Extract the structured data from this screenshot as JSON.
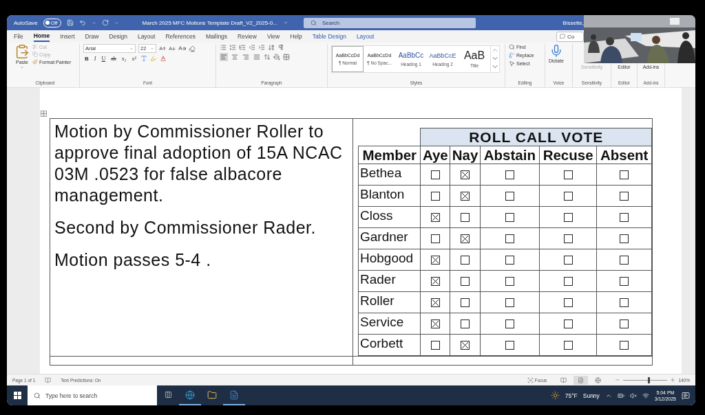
{
  "title_bar": {
    "autosave": {
      "label": "AutoSave",
      "state": "Off",
      "on": false
    },
    "document_title": "March 2025 MFC Motions Template Draft_V2_2025-0...",
    "search": {
      "placeholder": "Search"
    },
    "user": "Bissette,"
  },
  "ribbon_tabs": [
    {
      "label": "File",
      "selected": false,
      "contextual": false
    },
    {
      "label": "Home",
      "selected": true,
      "contextual": false
    },
    {
      "label": "Insert",
      "selected": false,
      "contextual": false
    },
    {
      "label": "Draw",
      "selected": false,
      "contextual": false
    },
    {
      "label": "Design",
      "selected": false,
      "contextual": false
    },
    {
      "label": "Layout",
      "selected": false,
      "contextual": false
    },
    {
      "label": "References",
      "selected": false,
      "contextual": false
    },
    {
      "label": "Mailings",
      "selected": false,
      "contextual": false
    },
    {
      "label": "Review",
      "selected": false,
      "contextual": false
    },
    {
      "label": "View",
      "selected": false,
      "contextual": false
    },
    {
      "label": "Help",
      "selected": false,
      "contextual": false
    },
    {
      "label": "Table Design",
      "selected": false,
      "contextual": true
    },
    {
      "label": "Layout",
      "selected": false,
      "contextual": true
    }
  ],
  "comments_button": "Co",
  "ribbon": {
    "clipboard": {
      "paste": "Paste",
      "cut": "Cut",
      "copy": "Copy",
      "format_painter": "Format Painter",
      "label": "Clipboard"
    },
    "font": {
      "name": "Arial",
      "size": "22",
      "label": "Font",
      "format_buttons": [
        {
          "label": "B",
          "kind": "bold"
        },
        {
          "label": "I",
          "kind": "italic"
        },
        {
          "label": "U",
          "kind": "underline"
        },
        {
          "label": "ab",
          "kind": "strike"
        },
        {
          "label": "x₂",
          "kind": "sub"
        },
        {
          "label": "x²",
          "kind": "sup"
        }
      ]
    },
    "paragraph": {
      "label": "Paragraph",
      "align_buttons": [
        {
          "kind": "left",
          "selected": true
        },
        {
          "kind": "center",
          "selected": false
        },
        {
          "kind": "right",
          "selected": false
        },
        {
          "kind": "justify",
          "selected": false
        }
      ]
    },
    "styles": {
      "label": "Styles",
      "items": [
        {
          "preview": "AaBbCcDd",
          "name": "¶ Normal",
          "kind": "normal",
          "selected": true
        },
        {
          "preview": "AaBbCcDd",
          "name": "¶ No Spac...",
          "kind": "nospacing",
          "selected": false
        },
        {
          "preview": "AaBbCc",
          "name": "Heading 1",
          "kind": "heading1",
          "selected": false
        },
        {
          "preview": "AaBbCcE",
          "name": "Heading 2",
          "kind": "heading2",
          "selected": false
        },
        {
          "preview": "AaB",
          "name": "Title",
          "kind": "title",
          "selected": false
        }
      ]
    },
    "editing": {
      "label": "Editing",
      "find": "Find",
      "replace": "Replace",
      "select": "Select"
    },
    "voice": {
      "label": "Voice",
      "dictate": "Dictate"
    },
    "sensitivity": {
      "label": "Sensitivity",
      "button": "Sensitivity",
      "disabled": true
    },
    "editor": {
      "label": "Editor",
      "button": "Editor"
    },
    "addins": {
      "label": "Add-ins",
      "button": "Add-ins"
    }
  },
  "document": {
    "motion_paragraphs": [
      "Motion by Commissioner Roller to approve final adoption of 15A NCAC 03M .0523 for false albacore management.",
      "Second by Commissioner Rader.",
      "Motion passes 5-4 ."
    ],
    "vote_table": {
      "title": "ROLL CALL VOTE",
      "member_header": "Member",
      "columns": [
        "Aye",
        "Nay",
        "Abstain",
        "Recuse",
        "Absent"
      ],
      "members": [
        {
          "name": "Bethea",
          "votes": [
            {
              "checked": false
            },
            {
              "checked": true
            },
            {
              "checked": false
            },
            {
              "checked": false
            },
            {
              "checked": false
            }
          ]
        },
        {
          "name": "Blanton",
          "votes": [
            {
              "checked": false
            },
            {
              "checked": true
            },
            {
              "checked": false
            },
            {
              "checked": false
            },
            {
              "checked": false
            }
          ]
        },
        {
          "name": "Closs",
          "votes": [
            {
              "checked": true
            },
            {
              "checked": false
            },
            {
              "checked": false
            },
            {
              "checked": false
            },
            {
              "checked": false
            }
          ]
        },
        {
          "name": "Gardner",
          "votes": [
            {
              "checked": false
            },
            {
              "checked": true
            },
            {
              "checked": false
            },
            {
              "checked": false
            },
            {
              "checked": false
            }
          ]
        },
        {
          "name": "Hobgood",
          "votes": [
            {
              "checked": true
            },
            {
              "checked": false
            },
            {
              "checked": false
            },
            {
              "checked": false
            },
            {
              "checked": false
            }
          ]
        },
        {
          "name": "Rader",
          "votes": [
            {
              "checked": true
            },
            {
              "checked": false
            },
            {
              "checked": false
            },
            {
              "checked": false
            },
            {
              "checked": false
            }
          ]
        },
        {
          "name": "Roller",
          "votes": [
            {
              "checked": true
            },
            {
              "checked": false
            },
            {
              "checked": false
            },
            {
              "checked": false
            },
            {
              "checked": false
            }
          ]
        },
        {
          "name": "Service",
          "votes": [
            {
              "checked": true
            },
            {
              "checked": false
            },
            {
              "checked": false
            },
            {
              "checked": false
            },
            {
              "checked": false
            }
          ]
        },
        {
          "name": "Corbett",
          "votes": [
            {
              "checked": false
            },
            {
              "checked": true
            },
            {
              "checked": false
            },
            {
              "checked": false
            },
            {
              "checked": false
            }
          ]
        }
      ]
    }
  },
  "status_bar": {
    "page": "Page 1 of 1",
    "text_predictions": "Text Predictions: On",
    "focus": "Focus",
    "views": [
      {
        "kind": "read",
        "selected": false
      },
      {
        "kind": "print",
        "selected": true
      },
      {
        "kind": "web",
        "selected": false
      }
    ],
    "zoom": {
      "level": 0.55,
      "reading": "140%"
    }
  },
  "taskbar": {
    "search": {
      "placeholder": "Type here to search"
    },
    "apps": [
      {
        "kind": "browser",
        "running": true
      },
      {
        "kind": "folder",
        "running": false
      },
      {
        "kind": "word",
        "running": true
      }
    ],
    "weather": {
      "temperature": "75°F",
      "condition": "Sunny"
    },
    "time": "5:04 PM",
    "date": "3/12/2025"
  }
}
